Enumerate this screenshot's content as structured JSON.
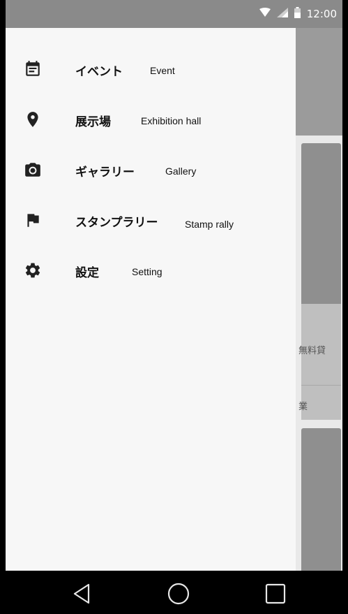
{
  "status_bar": {
    "time": "12:00",
    "icons": [
      "wifi-icon",
      "signal-icon",
      "battery-icon"
    ]
  },
  "drawer": {
    "items": [
      {
        "icon": "event-note-icon",
        "label_jp": "イベント",
        "label_en": "Event"
      },
      {
        "icon": "location-pin-icon",
        "label_jp": "展示場",
        "label_en": "Exhibition hall"
      },
      {
        "icon": "camera-icon",
        "label_jp": "ギャラリー",
        "label_en": "Gallery"
      },
      {
        "icon": "flag-icon",
        "label_jp": "スタンプラリー",
        "label_en": "Stamp rally"
      },
      {
        "icon": "settings-gear-icon",
        "label_jp": "設定",
        "label_en": "Setting"
      }
    ]
  },
  "background_app": {
    "card_text_1": "無料貸",
    "card_text_2": "業"
  },
  "nav_bar": {
    "icons": [
      "back-icon",
      "home-icon",
      "recents-icon"
    ]
  },
  "colors": {
    "drawer_bg": "#f7f7f7",
    "scrim_toolbar": "#9b9b9b",
    "status_bar": "#8a8a8a",
    "icon": "#222222"
  }
}
